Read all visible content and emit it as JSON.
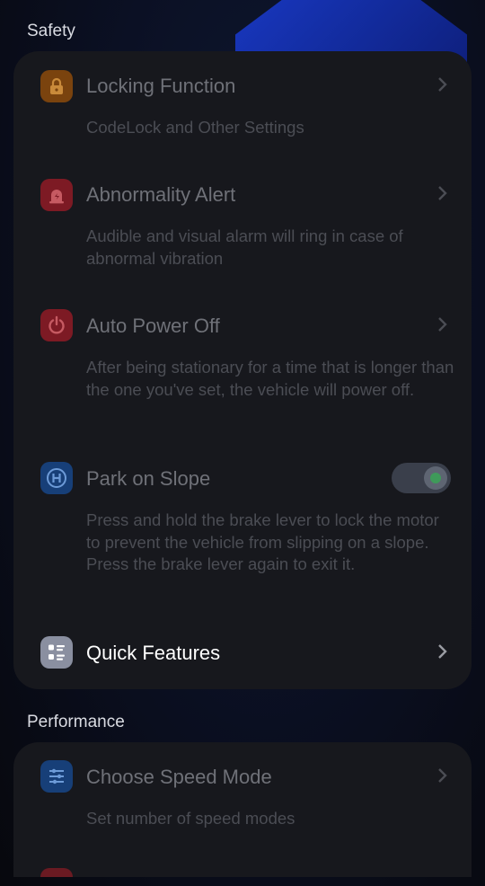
{
  "sections": {
    "safety": "Safety",
    "performance": "Performance"
  },
  "safety_items": {
    "locking": {
      "title": "Locking Function",
      "desc": "CodeLock and Other Settings",
      "icon": "lock-icon"
    },
    "alert": {
      "title": "Abnormality Alert",
      "desc": "Audible and visual alarm will ring in case of abnormal vibration",
      "icon": "alarm-icon"
    },
    "power": {
      "title": "Auto Power Off",
      "desc": "After being stationary for a time that is longer than the one you've set, the vehicle will power off.",
      "icon": "power-icon"
    },
    "park": {
      "title": "Park on Slope",
      "desc": "Press and hold the brake lever to lock the motor to prevent the vehicle from slipping on a slope. Press the brake lever again to exit it.",
      "icon": "park-icon",
      "toggle_on": true
    },
    "quick": {
      "title": "Quick Features",
      "icon": "grid-list-icon"
    }
  },
  "performance_items": {
    "speed": {
      "title": "Choose Speed Mode",
      "desc": "Set number of speed modes",
      "icon": "sliders-icon"
    }
  },
  "colors": {
    "lock": "#a35a12",
    "alert": "#a8232e",
    "power": "#a8232e",
    "park": "#1d5aa8",
    "quick": "#8a8fa0",
    "speed": "#1d5aa8"
  }
}
